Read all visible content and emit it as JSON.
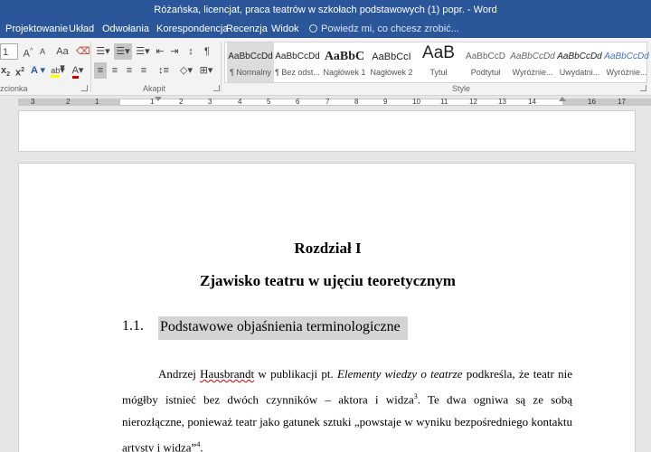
{
  "window": {
    "title": "Różańska, licencjat, praca teatrów w szkołach podstawowych (1) popr. - Word"
  },
  "tabs": [
    {
      "label": "Projektowanie"
    },
    {
      "label": "Układ"
    },
    {
      "label": "Odwołania"
    },
    {
      "label": "Korespondencja"
    },
    {
      "label": "Recenzja"
    },
    {
      "label": "Widok"
    }
  ],
  "tell_me": {
    "placeholder": "Powiedz mi, co chcesz zrobić..."
  },
  "ribbon": {
    "font_size_value": "1",
    "grow_font": "A",
    "shrink_font": "A",
    "change_case": "Aa",
    "subscript": "x",
    "superscript": "x",
    "text_effects": "A",
    "highlight": "ab",
    "font_color": "A",
    "show_marks": "¶",
    "groups": {
      "font": "zcionka",
      "paragraph": "Akapit",
      "styles": "Style"
    },
    "styles": [
      {
        "sample": "AaBbCcDd",
        "name": "¶ Normalny"
      },
      {
        "sample": "AaBbCcDd",
        "name": "¶ Bez odst..."
      },
      {
        "sample": "AaBbC",
        "name": "Nagłówek 1"
      },
      {
        "sample": "AaBbCcI",
        "name": "Nagłówek 2"
      },
      {
        "sample": "AaB",
        "name": "Tytuł"
      },
      {
        "sample": "AaBbCcD",
        "name": "Podtytuł"
      },
      {
        "sample": "AaBbCcDd",
        "name": "Wyróżnie..."
      },
      {
        "sample": "AaBbCcDd",
        "name": "Uwydatni..."
      },
      {
        "sample": "AaBbCcDd",
        "name": "Wyróżnie..."
      }
    ]
  },
  "ruler": {
    "numbers": [
      "3",
      "2",
      "1",
      "1",
      "2",
      "3",
      "4",
      "5",
      "6",
      "7",
      "8",
      "9",
      "10",
      "11",
      "12",
      "13",
      "14",
      "16",
      "17"
    ]
  },
  "document": {
    "chapter_title": "Rozdział I",
    "chapter_subtitle": "Zjawisko teatru w ujęciu teoretycznym",
    "section_number": "1.1.",
    "section_title": "Podstawowe objaśnienia terminologiczne",
    "paragraph": {
      "p1": "Andrzej ",
      "author_surname": "Hausbrandt",
      "p2": " w publikacji pt. ",
      "book_title": "Elementy wiedzy o teatrze",
      "p3": " podkreśla, że teatr nie mógłby istnieć bez dwóch czynników – aktora i widza",
      "fn1": "3",
      "p4": ". Te dwa ogniwa są ze sobą nierozłączne, ponieważ teatr jako gatunek sztuki „powstaje w wyniku bezpośredniego kontaktu artysty i widza”",
      "fn2": "4",
      "p5": "."
    }
  }
}
